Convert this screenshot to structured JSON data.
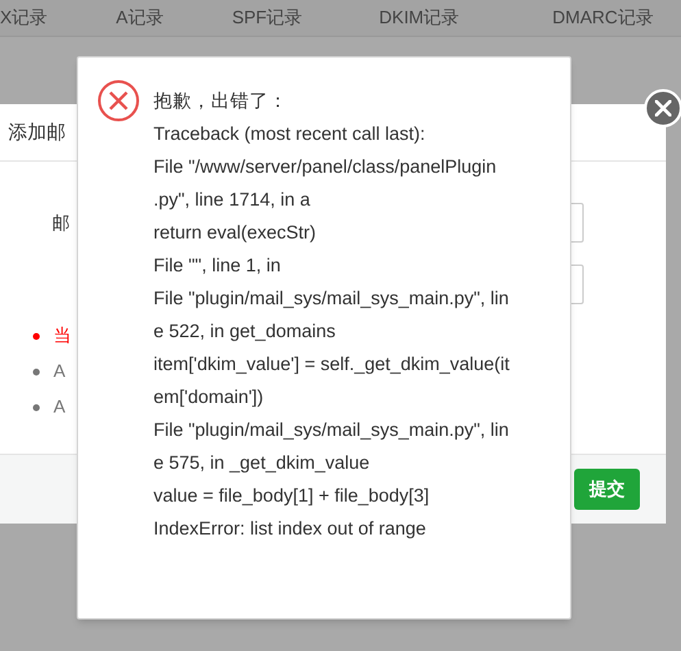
{
  "tabs": [
    {
      "label": "X记录"
    },
    {
      "label": "A记录"
    },
    {
      "label": "SPF记录"
    },
    {
      "label": "DKIM记录"
    },
    {
      "label": "DMARC记录"
    }
  ],
  "add_dialog": {
    "title": "添加邮",
    "field_label": "邮",
    "notes": [
      {
        "text": "当",
        "color": "#ff0000"
      },
      {
        "text": "A",
        "color": "#777777"
      },
      {
        "text": "A",
        "color": "#777777"
      }
    ],
    "submit": "提交"
  },
  "error_dialog": {
    "heading": "抱歉，出错了：",
    "lines": [
      "Traceback (most recent call last):",
      "File \"/www/server/panel/class/panelPlugin",
      ".py\", line 1714, in a",
      "return eval(execStr)",
      "File \"\", line 1, in",
      "File \"plugin/mail_sys/mail_sys_main.py\", lin",
      "e 522, in get_domains",
      "item['dkim_value'] = self._get_dkim_value(it",
      "em['domain'])",
      "File \"plugin/mail_sys/mail_sys_main.py\", lin",
      "e 575, in _get_dkim_value",
      "value = file_body[1] + file_body[3]",
      "IndexError: list index out of range"
    ]
  }
}
